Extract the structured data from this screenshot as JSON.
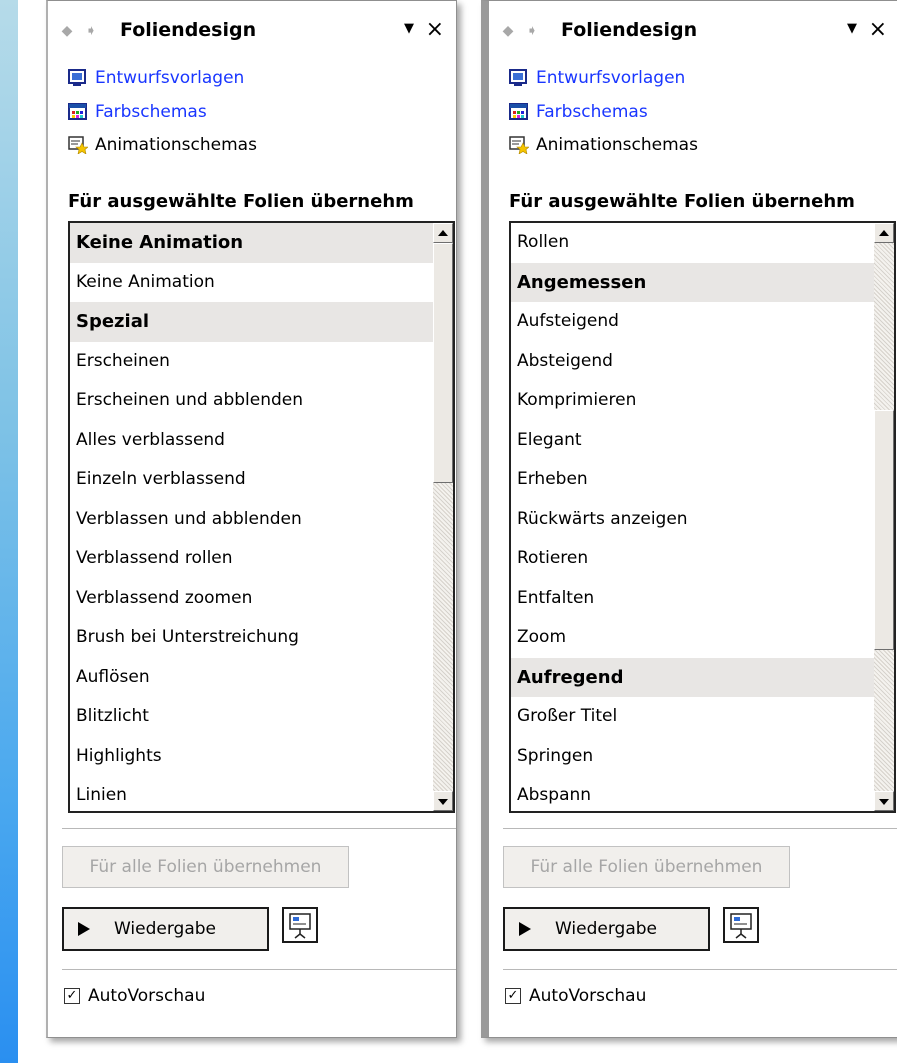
{
  "panels": [
    {
      "title": "Foliendesign",
      "nav_back_icon": "arrow-left-icon",
      "nav_forward_icon": "arrow-right-icon",
      "menu_icon": "dropdown-triangle-icon",
      "close_label": "×",
      "links": [
        {
          "label": "Entwurfsvorlagen",
          "icon": "design-template-icon",
          "color": "#1936ff"
        },
        {
          "label": "Farbschemas",
          "icon": "color-scheme-icon",
          "color": "#1936ff"
        },
        {
          "label": "Animationschemas",
          "icon": "animation-scheme-icon",
          "color": "#000000"
        }
      ],
      "section_label": "Für ausgewählte Folien übernehm",
      "list_items": [
        {
          "label": "Keine Animation",
          "header": true
        },
        {
          "label": "Keine Animation",
          "header": false
        },
        {
          "label": "Spezial",
          "header": true
        },
        {
          "label": "Erscheinen",
          "header": false
        },
        {
          "label": "Erscheinen und abblenden",
          "header": false
        },
        {
          "label": "Alles verblassend",
          "header": false
        },
        {
          "label": "Einzeln verblassend",
          "header": false
        },
        {
          "label": "Verblassen und abblenden",
          "header": false
        },
        {
          "label": "Verblassend rollen",
          "header": false
        },
        {
          "label": "Verblassend zoomen",
          "header": false
        },
        {
          "label": "Brush bei Unterstreichung",
          "header": false
        },
        {
          "label": "Auflösen",
          "header": false
        },
        {
          "label": "Blitzlicht",
          "header": false
        },
        {
          "label": "Highlights",
          "header": false
        },
        {
          "label": "Linien",
          "header": false
        }
      ],
      "scroll_position": 0.0,
      "apply_all_label": "Für alle Folien übernehmen",
      "play_label": "Wiedergabe",
      "slideshow_icon": "slideshow-icon",
      "autopreview_label": "AutoVorschau",
      "autopreview_checked": true
    },
    {
      "title": "Foliendesign",
      "nav_back_icon": "arrow-left-icon",
      "nav_forward_icon": "arrow-right-icon",
      "menu_icon": "dropdown-triangle-icon",
      "close_label": "×",
      "links": [
        {
          "label": "Entwurfsvorlagen",
          "icon": "design-template-icon",
          "color": "#1936ff"
        },
        {
          "label": "Farbschemas",
          "icon": "color-scheme-icon",
          "color": "#1936ff"
        },
        {
          "label": "Animationschemas",
          "icon": "animation-scheme-icon",
          "color": "#000000"
        }
      ],
      "section_label": "Für ausgewählte Folien übernehm",
      "list_items": [
        {
          "label": "Rollen",
          "header": false
        },
        {
          "label": "Angemessen",
          "header": true
        },
        {
          "label": "Aufsteigend",
          "header": false
        },
        {
          "label": "Absteigend",
          "header": false
        },
        {
          "label": "Komprimieren",
          "header": false
        },
        {
          "label": "Elegant",
          "header": false
        },
        {
          "label": "Erheben",
          "header": false
        },
        {
          "label": "Rückwärts anzeigen",
          "header": false
        },
        {
          "label": "Rotieren",
          "header": false
        },
        {
          "label": "Entfalten",
          "header": false
        },
        {
          "label": "Zoom",
          "header": false
        },
        {
          "label": "Aufregend",
          "header": true
        },
        {
          "label": "Großer Titel",
          "header": false
        },
        {
          "label": "Springen",
          "header": false
        },
        {
          "label": "Abspann",
          "header": false
        }
      ],
      "scroll_position": 0.55,
      "apply_all_label": "Für alle Folien übernehmen",
      "play_label": "Wiedergabe",
      "slideshow_icon": "slideshow-icon",
      "autopreview_label": "AutoVorschau",
      "autopreview_checked": true
    }
  ]
}
